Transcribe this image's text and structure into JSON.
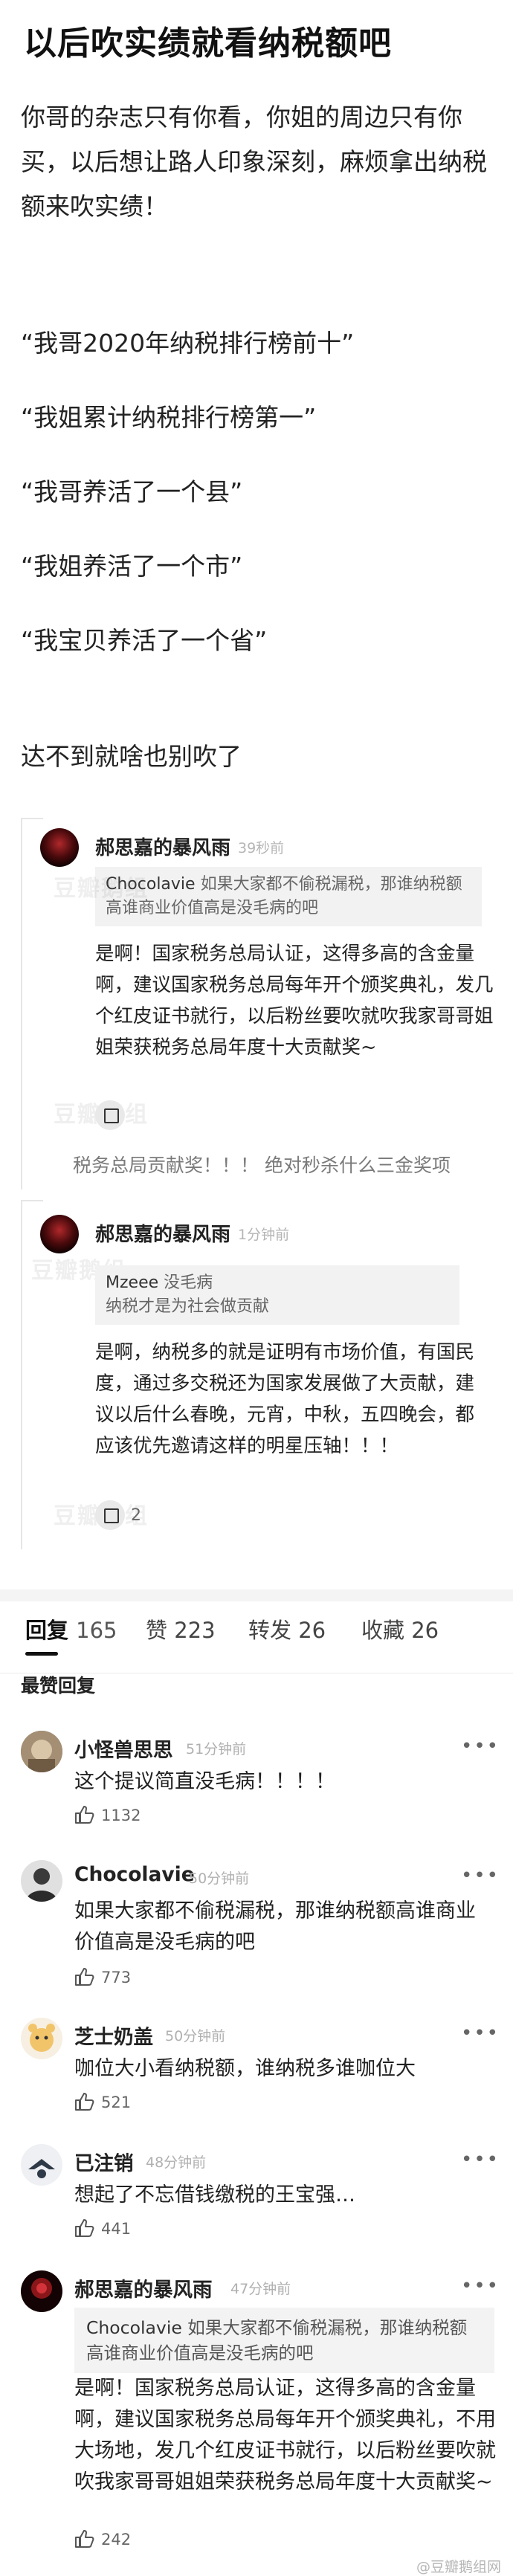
{
  "post": {
    "title": "以后吹实绩就看纳税额吧",
    "intro": "你哥的杂志只有你看，你姐的周边只有你买，以后想让路人印象深刻，麻烦拿出纳税额来吹实绩！",
    "quotes": [
      "“我哥2020年纳税排行榜前十”",
      "“我姐累计纳税排行榜第一”",
      "“我哥养活了一个县”",
      "“我姐养活了一个市”",
      "“我宝贝养活了一个省”"
    ],
    "closing": "达不到就啥也别吹了"
  },
  "embedded": [
    {
      "name": "郝思嘉的暴风雨",
      "time": "39秒前",
      "quote_author": "Chocolavie",
      "quote_text": "如果大家都不偷税漏税，那谁纳税额高谁商业价值高是没毛病的吧",
      "text": "是啊！国家税务总局认证，这得多高的含金量啊，建议国家税务总局每年开个颁奖典礼，发几个红皮证书就行，以后粉丝要吹就吹我家哥哥姐姐荣获税务总局年度十大贡献奖~",
      "caption": "税务总局贡献奖！！！ 绝对秒杀什么三金奖项",
      "watermark": "豆瓣鹅组"
    },
    {
      "name": "郝思嘉的暴风雨",
      "time": "1分钟前",
      "quote_author": "Mzeee",
      "quote_text": "没毛病",
      "quote_text2": "纳税才是为社会做贡献",
      "text": "是啊，纳税多的就是证明有市场价值，有国民度，通过多交税还为国家发展做了大贡献，建议以后什么春晚，元宵，中秋，五四晚会，都应该优先邀请这样的明星压轴！！！",
      "likes": "2",
      "watermark": "豆瓣鹅组"
    }
  ],
  "tabs": [
    {
      "label": "回复",
      "count": "165"
    },
    {
      "label": "赞",
      "count": "223"
    },
    {
      "label": "转发",
      "count": "26"
    },
    {
      "label": "收藏",
      "count": "26"
    }
  ],
  "section_label": "最赞回复",
  "comments": [
    {
      "name": "小怪兽思思",
      "time": "51分钟前",
      "text": "这个提议简直没毛病！！！！",
      "likes": "1132"
    },
    {
      "name": "Chocolavie",
      "time": "50分钟前",
      "text": "如果大家都不偷税漏税，那谁纳税额高谁商业价值高是没毛病的吧",
      "likes": "773"
    },
    {
      "name": "芝士奶盖",
      "time": "50分钟前",
      "text": "咖位大小看纳税额，谁纳税多谁咖位大",
      "likes": "521"
    },
    {
      "name": "已注销",
      "time": "48分钟前",
      "text": "想起了不忘借钱缴税的王宝强…",
      "likes": "441"
    },
    {
      "name": "郝思嘉的暴风雨",
      "time": "47分钟前",
      "quote_author": "Chocolavie",
      "quote_text": "如果大家都不偷税漏税，那谁纳税额高谁商业价值高是没毛病的吧",
      "text": "是啊！国家税务总局认证，这得多高的含金量啊，建议国家税务总局每年开个颁奖典礼，不用大场地，发几个红皮证书就行，以后粉丝要吹就吹我家哥哥姐姐荣获税务总局年度十大贡献奖~",
      "likes": "242"
    }
  ],
  "more_label": "•••",
  "footer_watermark": "@豆瓣鹅组网"
}
